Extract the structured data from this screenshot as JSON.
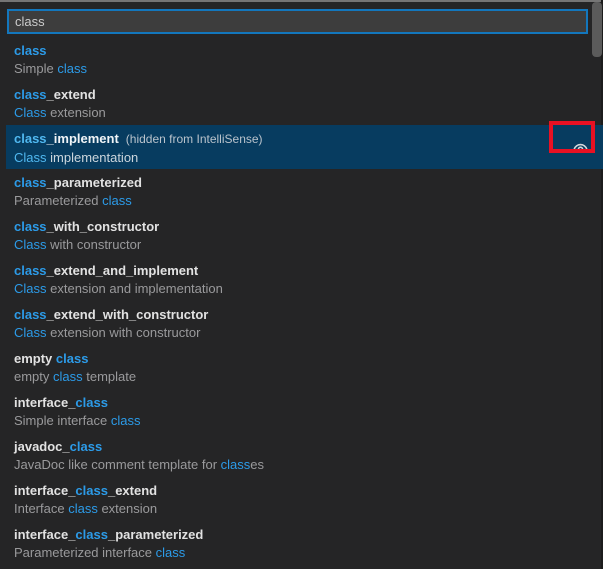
{
  "widget": "vscode-quick-pick",
  "input": {
    "value": "class",
    "placeholder": ""
  },
  "colors": {
    "panel_background": "#252526",
    "input_background": "#3d3d3d",
    "input_focus_border": "#1377bd",
    "match_highlight_blue": "#2c9be8",
    "selected_match_highlight_blue": "#50b8f0",
    "selected_row_background": "#073c60",
    "label_text": "#e2e2e2",
    "description_text": "#9a9a9c",
    "annotation_red": "#e81123"
  },
  "list": {
    "items": [
      {
        "id": "class",
        "selected": false,
        "label_parts": [
          {
            "text": "class",
            "match": true
          }
        ],
        "desc_parts": [
          {
            "text": "Simple ",
            "match": false
          },
          {
            "text": "class",
            "match": true
          }
        ]
      },
      {
        "id": "class_extend",
        "selected": false,
        "label_parts": [
          {
            "text": "class",
            "match": true
          },
          {
            "text": "_extend",
            "match": false
          }
        ],
        "desc_parts": [
          {
            "text": "Class",
            "match": true
          },
          {
            "text": " extension",
            "match": false
          }
        ]
      },
      {
        "id": "class_implement",
        "selected": true,
        "note": "(hidden from IntelliSense)",
        "has_eye_button": true,
        "label_parts": [
          {
            "text": "class",
            "match": true
          },
          {
            "text": "_implement",
            "match": false
          }
        ],
        "desc_parts": [
          {
            "text": "Class",
            "match": true
          },
          {
            "text": " implementation",
            "match": false
          }
        ]
      },
      {
        "id": "class_parameterized",
        "selected": false,
        "label_parts": [
          {
            "text": "class",
            "match": true
          },
          {
            "text": "_parameterized",
            "match": false
          }
        ],
        "desc_parts": [
          {
            "text": "Parameterized ",
            "match": false
          },
          {
            "text": "class",
            "match": true
          }
        ]
      },
      {
        "id": "class_with_constructor",
        "selected": false,
        "label_parts": [
          {
            "text": "class",
            "match": true
          },
          {
            "text": "_with_constructor",
            "match": false
          }
        ],
        "desc_parts": [
          {
            "text": "Class",
            "match": true
          },
          {
            "text": " with constructor",
            "match": false
          }
        ]
      },
      {
        "id": "class_extend_and_implement",
        "selected": false,
        "label_parts": [
          {
            "text": "class",
            "match": true
          },
          {
            "text": "_extend_and_implement",
            "match": false
          }
        ],
        "desc_parts": [
          {
            "text": "Class",
            "match": true
          },
          {
            "text": " extension and implementation",
            "match": false
          }
        ]
      },
      {
        "id": "class_extend_with_constructor",
        "selected": false,
        "label_parts": [
          {
            "text": "class",
            "match": true
          },
          {
            "text": "_extend_with_constructor",
            "match": false
          }
        ],
        "desc_parts": [
          {
            "text": "Class",
            "match": true
          },
          {
            "text": " extension with constructor",
            "match": false
          }
        ]
      },
      {
        "id": "empty_class",
        "selected": false,
        "label_parts": [
          {
            "text": "empty ",
            "match": false
          },
          {
            "text": "class",
            "match": true
          }
        ],
        "desc_parts": [
          {
            "text": "empty ",
            "match": false
          },
          {
            "text": "class",
            "match": true
          },
          {
            "text": " template",
            "match": false
          }
        ]
      },
      {
        "id": "interface_class",
        "selected": false,
        "label_parts": [
          {
            "text": "interface_",
            "match": false
          },
          {
            "text": "class",
            "match": true
          }
        ],
        "desc_parts": [
          {
            "text": "Simple interface ",
            "match": false
          },
          {
            "text": "class",
            "match": true
          }
        ]
      },
      {
        "id": "javadoc_class",
        "selected": false,
        "label_parts": [
          {
            "text": "javadoc_",
            "match": false
          },
          {
            "text": "class",
            "match": true
          }
        ],
        "desc_parts": [
          {
            "text": "JavaDoc like comment template for ",
            "match": false
          },
          {
            "text": "class",
            "match": true
          },
          {
            "text": "es",
            "match": false
          }
        ]
      },
      {
        "id": "interface_class_extend",
        "selected": false,
        "label_parts": [
          {
            "text": "interface_",
            "match": false
          },
          {
            "text": "class",
            "match": true
          },
          {
            "text": "_extend",
            "match": false
          }
        ],
        "desc_parts": [
          {
            "text": "Interface ",
            "match": false
          },
          {
            "text": "class",
            "match": true
          },
          {
            "text": " extension",
            "match": false
          }
        ]
      },
      {
        "id": "interface_class_parameterized",
        "selected": false,
        "label_parts": [
          {
            "text": "interface_",
            "match": false
          },
          {
            "text": "class",
            "match": true
          },
          {
            "text": "_parameterized",
            "match": false
          }
        ],
        "desc_parts": [
          {
            "text": "Parameterized interface ",
            "match": false
          },
          {
            "text": "class",
            "match": true
          }
        ]
      }
    ]
  },
  "annotation": {
    "kind": "red-highlight-box",
    "target": "eye-toggle-button-of-class_implement"
  }
}
